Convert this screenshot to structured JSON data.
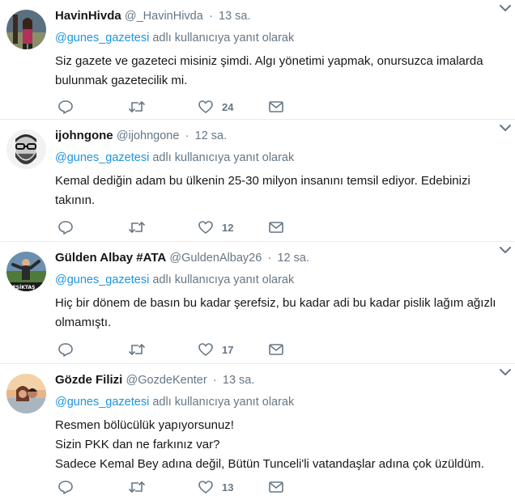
{
  "reply_prefix_suffix": "adlı kullanıcıya yanıt olarak",
  "tweets": [
    {
      "name": "HavinHivda",
      "handle": "@_HavinHivda",
      "dot": "·",
      "time": "13 sa.",
      "mention": "@gunes_gazetesi",
      "reply_to_text": "adlı kullanıcıya yanıt olarak",
      "lines": [
        "Siz gazete ve gazeteci misiniz şimdi. Algı yönetimi yapmak, onursuzca imalarda",
        "bulunmak gazetecilik mi."
      ],
      "like_count": "24"
    },
    {
      "name": "ijohngone",
      "handle": "@ijohngone",
      "dot": "·",
      "time": "12 sa.",
      "mention": "@gunes_gazetesi",
      "reply_to_text": "adlı kullanıcıya yanıt olarak",
      "lines": [
        "Kemal dediğin adam bu ülkenin 25-30 milyon insanını temsil ediyor. Edebinizi",
        "takının."
      ],
      "like_count": "12"
    },
    {
      "name": "Gülden Albay #ATA",
      "handle": "@GuldenAlbay26",
      "dot": "·",
      "time": "12 sa.",
      "mention": "@gunes_gazetesi",
      "reply_to_text": "adlı kullanıcıya yanıt olarak",
      "lines": [
        "Hiç bir dönem de basın bu kadar şerefsiz, bu kadar adi bu kadar pislik lağım ağızlı",
        "olmamıştı."
      ],
      "like_count": "17"
    },
    {
      "name": "Gözde Filizi",
      "handle": "@GozdeKenter",
      "dot": "·",
      "time": "13 sa.",
      "mention": "@gunes_gazetesi",
      "reply_to_text": "adlı kullanıcıya yanıt olarak",
      "lines": [
        "Resmen bölücülük yapıyorsunuz!",
        "Sizin PKK dan ne farkınız var?",
        "Sadece Kemal Bey adına değil, Bütün Tunceli'li vatandaşlar adına çok üzüldüm."
      ],
      "like_count": "13"
    }
  ],
  "avatar3_badge": "BEŞİKTAŞ",
  "icons": {
    "reply": "reply-icon",
    "retweet": "retweet-icon",
    "like": "heart-icon",
    "dm": "envelope-icon",
    "more": "chevron-down-icon"
  },
  "colors": {
    "name": "#14171a",
    "meta": "#657786",
    "mention": "#1b95e0",
    "divider": "#e6ecf0"
  }
}
